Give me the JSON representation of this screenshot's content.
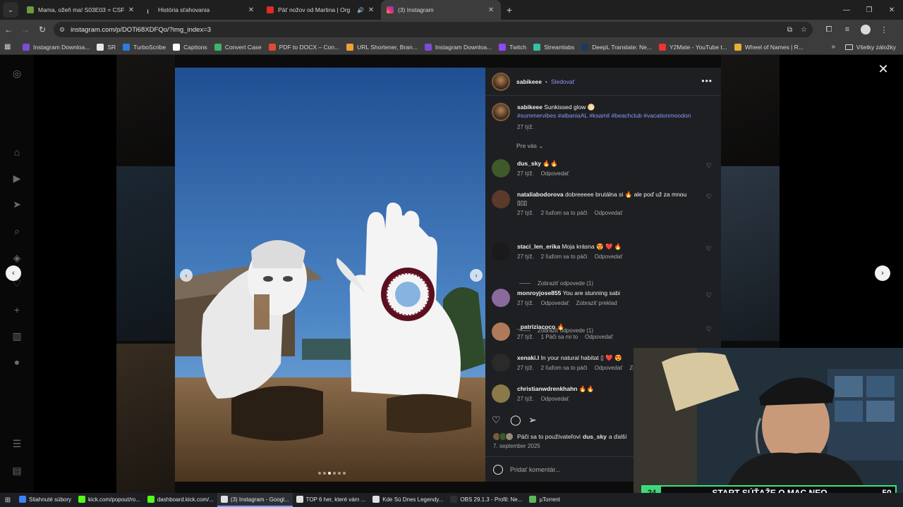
{
  "browser": {
    "tabs": [
      {
        "title": "Mama, ožeň ma! S03E03 = CSF",
        "color": "#6a9b3f",
        "active": false,
        "audio": false
      },
      {
        "title": "História sťahovania",
        "color": "#cfcfcf",
        "active": false,
        "audio": false
      },
      {
        "title": "Päť nožov od Martina | Org",
        "color": "#e02a2a",
        "active": false,
        "audio": true
      },
      {
        "title": "(3) Instagram",
        "color": "#d6307f",
        "active": true,
        "audio": false
      }
    ],
    "url": "instagram.com/p/DOTi68XDFQo/?img_index=3",
    "bookmarks": [
      {
        "label": "Instagram Downloa...",
        "color": "#7b4dd6"
      },
      {
        "label": "SR",
        "color": "#e8e8e8"
      },
      {
        "label": "TurboScribe",
        "color": "#2f7be0"
      },
      {
        "label": "Captions",
        "color": "#ffffff"
      },
      {
        "label": "Convert Case",
        "color": "#3fb56b"
      },
      {
        "label": "PDF to DOCX – Con...",
        "color": "#e04a2f"
      },
      {
        "label": "URL Shortener, Bran...",
        "color": "#f0a030"
      },
      {
        "label": "Instagram Downloa...",
        "color": "#7b4dd6"
      },
      {
        "label": "Twitch",
        "color": "#9147ff"
      },
      {
        "label": "Streamlabs",
        "color": "#31c3a2"
      },
      {
        "label": "DeepL Translate: Ne...",
        "color": "#1b3a5c"
      },
      {
        "label": "Y2Mate - YouTube t...",
        "color": "#e33"
      },
      {
        "label": "Wheel of Names | R...",
        "color": "#e8b030"
      }
    ],
    "all_bookmarks": "Všetky záložky"
  },
  "post": {
    "username": "sabikeee",
    "follow": "Sledovať",
    "caption_user": "sabikeee",
    "caption_text": "Sunkissed glow 🌕",
    "hashtags": "#summervibes #albaniaAL #ksamil #beachclub #vacationmoodon",
    "caption_time": "27 týž.",
    "sort": "Pre vás",
    "comments": [
      {
        "user": "dus_sky",
        "text": "🔥🔥",
        "time": "27 týž.",
        "likes": "",
        "reply": "Odpovedať",
        "extra": "",
        "color": "#3f5a2a"
      },
      {
        "user": "nataliabodorova",
        "text": "dobreeeee brutálna si 🔥 ale poď už za mnou",
        "text2": "▯▯▯",
        "time": "27 týž.",
        "likes": "2 ľuďom sa to páči",
        "reply": "Odpovedať",
        "extra": "",
        "color": "#5a3a2a"
      },
      {
        "user": "staci_len_erika",
        "text": "Moja krásna 😍 ❤️ 🔥",
        "time": "27 týž.",
        "likes": "2 ľuďom sa to páči",
        "reply": "Odpovedať",
        "extra": "",
        "color": "#1a1a1a"
      },
      {
        "user": "monroyjose855",
        "text": "You are stunning sabi",
        "time": "27 týž.",
        "likes": "",
        "reply": "Odpovedať",
        "extra": "Zobraziť preklad",
        "color": "#8a6a9a"
      },
      {
        "user": "_patriziacoco",
        "text": "🔥",
        "time": "27 týž.",
        "likes": "1 Páči sa mi to",
        "reply": "Odpovedať",
        "extra": "",
        "color": "#b07a5a"
      },
      {
        "user": "xenaki.l",
        "text": "In your natural habitat ▯ ❤️ 😍",
        "time": "27 týž.",
        "likes": "2 ľuďom sa to páči",
        "reply": "Odpovedať",
        "extra": "Zo",
        "color": "#2a2a2a"
      },
      {
        "user": "christianwdrenkhahn",
        "text": "🔥🔥",
        "time": "27 týž.",
        "likes": "",
        "reply": "Odpovedať",
        "extra": "",
        "color": "#8a7a4a"
      }
    ],
    "view_replies_1": "Zobraziť odpovede (1)",
    "view_replies_2": "Zobraziť odpovede (1)",
    "likes_prefix": "Páči sa to používateľovi",
    "likes_user": "dus_sky",
    "likes_suffix": "a ďalší",
    "date": "7. september 2025",
    "add_comment": "Pridať komentár..."
  },
  "stream_overlay": {
    "left_number": "24",
    "text": "START SÚŤAŽE O MAC NEO",
    "right_number": "50",
    "accent": "#39e37d"
  },
  "taskbar": [
    {
      "label": "Stiahnuté súbory",
      "color": "#3b82f6"
    },
    {
      "label": "kick.com/popout/ro...",
      "color": "#53fc18"
    },
    {
      "label": "dashboard.kick.com/...",
      "color": "#53fc18"
    },
    {
      "label": "(3) Instagram - Googl...",
      "color": "#e0e0e0",
      "active": true
    },
    {
      "label": "TOP 6 her, které vám ...",
      "color": "#e0e0e0"
    },
    {
      "label": "Kde Sú Dnes Legendy...",
      "color": "#e0e0e0"
    },
    {
      "label": "OBS 29.1.3 - Profil: Ne...",
      "color": "#303030"
    },
    {
      "label": "µTorrent",
      "color": "#5cb85c"
    }
  ]
}
